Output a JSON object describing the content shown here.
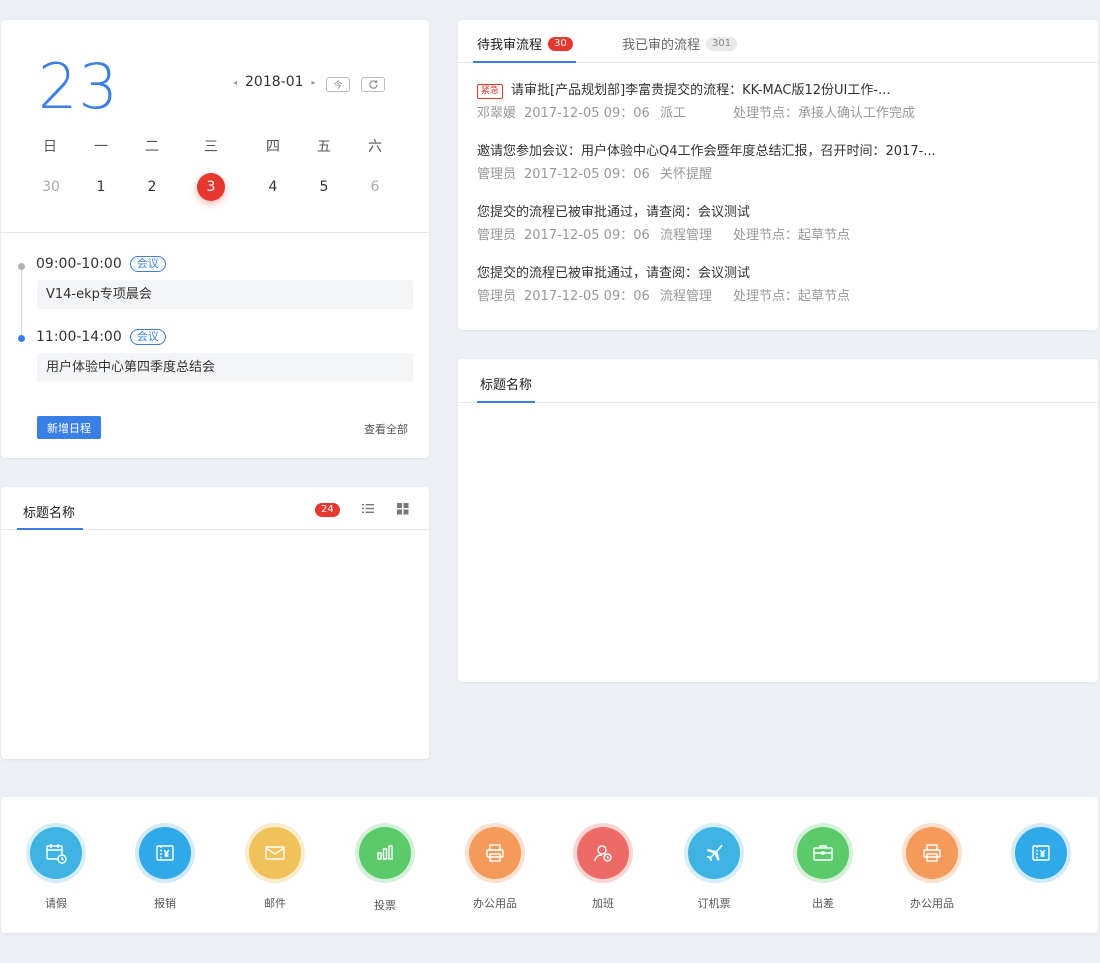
{
  "calendar": {
    "big_day": "23",
    "month": "2018-01",
    "prev_arrow": "◂",
    "next_arrow": "▸",
    "today_btn": "今",
    "weekdays": [
      "日",
      "一",
      "二",
      "三",
      "四",
      "五",
      "六"
    ],
    "days": [
      "30",
      "1",
      "2",
      "3",
      "4",
      "5",
      "6"
    ],
    "events": [
      {
        "time": "09:00-10:00",
        "tag": "会议",
        "title": "V14-ekp专项晨会"
      },
      {
        "time": "11:00-14:00",
        "tag": "会议",
        "title": "用户体验中心第四季度总结会"
      }
    ],
    "add_btn": "新增日程",
    "view_all": "查看全部"
  },
  "list_card": {
    "title": "标题名称",
    "badge": "24"
  },
  "flow_card": {
    "tabs": [
      {
        "label": "待我审流程",
        "badge": "30"
      },
      {
        "label": "我已审的流程",
        "badge": "301"
      }
    ],
    "items": [
      {
        "tag": "紧急",
        "title": "请审批[产品规划部]李富贵提交的流程：KK-MAC版12份UI工作-...",
        "person": "邓翠媛",
        "time": "2017-12-05  09：06",
        "type": "派工",
        "node": "处理节点：承接人确认工作完成"
      },
      {
        "tag": "",
        "title": "邀请您参加会议：用户体验中心Q4工作会暨年度总结汇报，召开时间：2017-...",
        "person": "管理员",
        "time": "2017-12-05  09：06",
        "type": "关怀提醒",
        "node": ""
      },
      {
        "tag": "",
        "title": "您提交的流程已被审批通过，请查阅：会议测试",
        "person": "管理员",
        "time": "2017-12-05  09：06",
        "type": "流程管理",
        "node": "处理节点：起草节点"
      },
      {
        "tag": "",
        "title": "您提交的流程已被审批通过，请查阅：会议测试",
        "person": "管理员",
        "time": "2017-12-05  09：06",
        "type": "流程管理",
        "node": "处理节点：起草节点"
      }
    ]
  },
  "blank_card": {
    "title": "标题名称"
  },
  "apps": [
    {
      "label": "请假",
      "icon": "calendar-icon",
      "color": "#3fb4e3",
      "ring": "#d5eef8"
    },
    {
      "label": "报销",
      "icon": "receipt-icon",
      "color": "#30a9e8",
      "ring": "#d3ebf8"
    },
    {
      "label": "邮件",
      "icon": "mail-icon",
      "color": "#f2c25a",
      "ring": "#faeccc"
    },
    {
      "label": "投票",
      "icon": "chart-icon",
      "color": "#5cc96b",
      "ring": "#d6f1d9"
    },
    {
      "label": "办公用品",
      "icon": "printer-icon",
      "color": "#f49a5a",
      "ring": "#fbe1cf"
    },
    {
      "label": "加班",
      "icon": "overtime-icon",
      "color": "#ec6b66",
      "ring": "#f9d6d4"
    },
    {
      "label": "订机票",
      "icon": "plane-icon",
      "color": "#3fb4e3",
      "ring": "#d5eef8"
    },
    {
      "label": "出差",
      "icon": "briefcase-icon",
      "color": "#5cc96b",
      "ring": "#d6f1d9"
    },
    {
      "label": "办公用品",
      "icon": "printer-icon",
      "color": "#f49a5a",
      "ring": "#fbe1cf"
    },
    {
      "label": "",
      "icon": "receipt-icon",
      "color": "#30a9e8",
      "ring": "#d3ebf8"
    }
  ]
}
